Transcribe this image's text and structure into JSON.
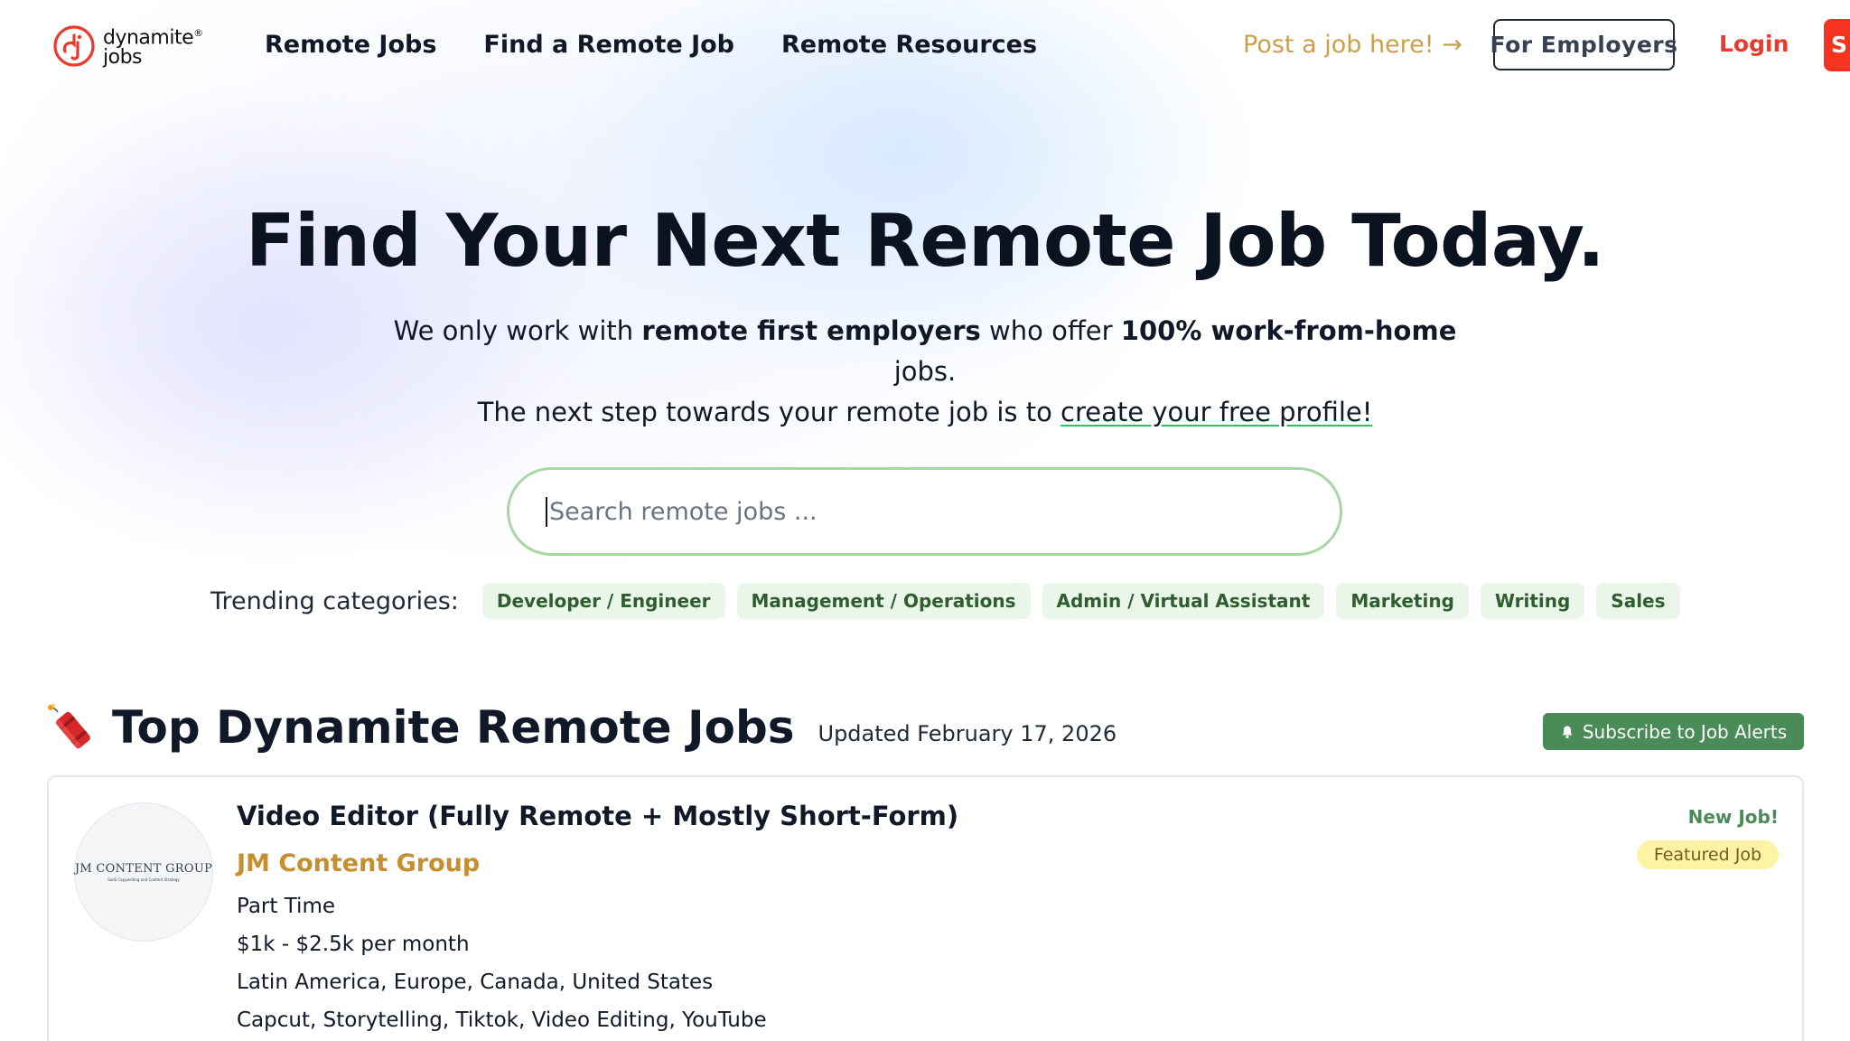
{
  "brand": {
    "logo_line1": "dynamite",
    "logo_line2": "jobs",
    "trademark": "®"
  },
  "nav": {
    "items": [
      "Remote Jobs",
      "Find a Remote Job",
      "Remote Resources"
    ]
  },
  "header": {
    "post_job": "Post a job here! →",
    "for_employers": "For Employers",
    "login": "Login",
    "signup_partial": "S"
  },
  "hero": {
    "title": "Find Your Next Remote Job Today.",
    "sub_1": "We only work with ",
    "sub_bold_1": "remote first employers",
    "sub_2": " who offer ",
    "sub_bold_2": "100% work-from-home",
    "sub_3": " jobs.",
    "sub_4": "The next step towards your remote job is to ",
    "sub_link": "create your free profile!"
  },
  "search": {
    "placeholder": "Search remote jobs ...",
    "value": ""
  },
  "trending": {
    "label": "Trending categories:",
    "categories": [
      "Developer / Engineer",
      "Management / Operations",
      "Admin / Virtual Assistant",
      "Marketing",
      "Writing",
      "Sales"
    ]
  },
  "jobs_section": {
    "title": "Top Dynamite Remote Jobs",
    "updated": "Updated February 17, 2026",
    "subscribe": "Subscribe to Job Alerts"
  },
  "job": {
    "title": "Video Editor (Fully Remote + Mostly Short-Form)",
    "company": "JM Content Group",
    "logo_name": "JM CONTENT GROUP",
    "logo_tagline": "SaaS Copywriting and Content Strategy",
    "type": "Part Time",
    "salary": "$1k - $2.5k per month",
    "locations": "Latin America, Europe, Canada, United States",
    "skills": "Capcut, Storytelling, Tiktok, Video Editing, YouTube",
    "new_label": "New Job!",
    "featured_label": "Featured Job"
  },
  "colors": {
    "brand_red": "#e63b2e",
    "post_job_gold": "#caa14a",
    "chip_bg": "#eaf6ea",
    "chip_text": "#2f5d2f",
    "subscribe_green": "#4b8b57",
    "company_gold": "#c58f2f",
    "featured_bg": "#fcf3a5"
  },
  "icons": {
    "logo": "dynamite-jobs-logo-icon",
    "section": "firecracker-icon",
    "subscribe": "bell-icon"
  }
}
